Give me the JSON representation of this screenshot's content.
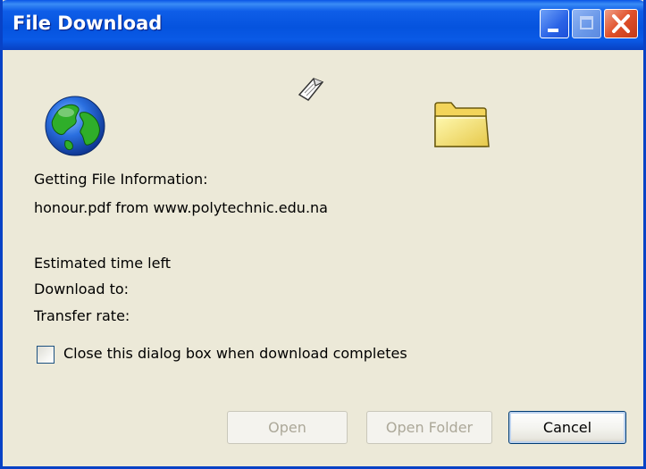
{
  "window": {
    "title": "File Download"
  },
  "status": {
    "line1": "Getting File Information:",
    "line2": "honour.pdf from www.polytechnic.edu.na",
    "estimated_time_label": "Estimated time left",
    "download_to_label": "Download to:",
    "transfer_rate_label": "Transfer rate:"
  },
  "options": {
    "close_on_complete_label": "Close this dialog box when download completes",
    "close_on_complete_checked": false
  },
  "buttons": {
    "open": "Open",
    "open_folder": "Open Folder",
    "cancel": "Cancel"
  },
  "icons": {
    "globe": "globe-icon",
    "document": "flying-document-icon",
    "folder": "folder-icon"
  },
  "colors": {
    "titlebar_blue": "#0553de",
    "dialog_bg": "#ece9d8",
    "close_red": "#e0502a",
    "disabled_text": "#aca899"
  }
}
